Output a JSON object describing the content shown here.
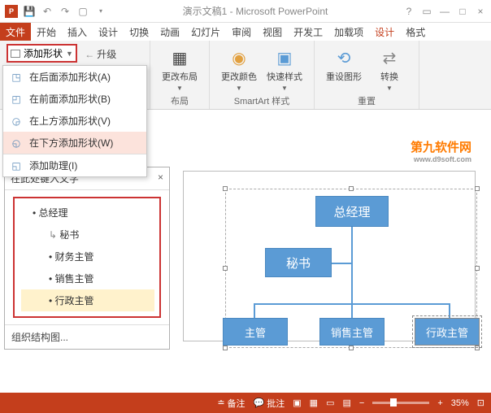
{
  "title": "演示文稿1 - Microsoft PowerPoint",
  "tabs": {
    "file": "文件",
    "t0": "开始",
    "t1": "插入",
    "t2": "设计",
    "t3": "切换",
    "t4": "动画",
    "t5": "幻灯片",
    "t6": "审阅",
    "t7": "视图",
    "t8": "开发工",
    "t9": "加载项",
    "t10": "设计",
    "t11": "格式"
  },
  "ribbon": {
    "add_shape": "添加形状",
    "upgrade": "升级",
    "group1": "布局",
    "change_layout": "更改布局",
    "change_color": "更改颜色",
    "quick_style": "快速样式",
    "group2": "SmartArt 样式",
    "reset_graphic": "重设图形",
    "convert": "转换",
    "group3": "重置"
  },
  "dropdown": {
    "after": "在后面添加形状(A)",
    "before": "在前面添加形状(B)",
    "above": "在上方添加形状(V)",
    "below": "在下方添加形状(W)",
    "assistant": "添加助理(I)"
  },
  "textpane": {
    "title": "在此处键入文字",
    "n1": "总经理",
    "n2": "秘书",
    "n3": "财务主管",
    "n4": "销售主管",
    "n5": "行政主管",
    "footer": "组织结构图..."
  },
  "chart_data": {
    "type": "org-chart",
    "nodes": {
      "root": "总经理",
      "assistant": "秘书",
      "c1": "主管",
      "c2": "销售主管",
      "c3": "行政主管"
    }
  },
  "watermark": {
    "text": "第九软件网",
    "url": "www.d9soft.com"
  },
  "status": {
    "notes": "备注",
    "comments": "批注",
    "zoom": "35%"
  }
}
